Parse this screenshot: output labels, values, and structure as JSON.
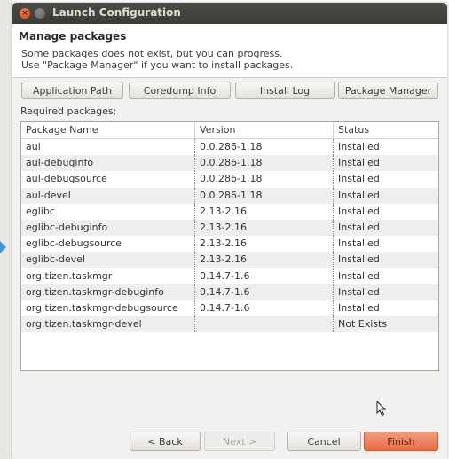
{
  "window": {
    "title": "Launch Configuration"
  },
  "header": {
    "title": "Manage packages",
    "message_line1": "Some packages does not exist, but you can progress.",
    "message_line2": "Use \"Package Manager\" if you want to install packages."
  },
  "buttons": {
    "application_path": "Application Path",
    "coredump_info": "Coredump Info",
    "install_log": "Install Log",
    "package_manager": "Package Manager"
  },
  "required_label": "Required packages:",
  "table": {
    "columns": [
      "Package Name",
      "Version",
      "Status"
    ],
    "rows": [
      {
        "name": "aul",
        "version": "0.0.286-1.18",
        "status": "Installed"
      },
      {
        "name": "aul-debuginfo",
        "version": "0.0.286-1.18",
        "status": "Installed"
      },
      {
        "name": "aul-debugsource",
        "version": "0.0.286-1.18",
        "status": "Installed"
      },
      {
        "name": "aul-devel",
        "version": "0.0.286-1.18",
        "status": "Installed"
      },
      {
        "name": "eglibc",
        "version": "2.13-2.16",
        "status": "Installed"
      },
      {
        "name": "eglibc-debuginfo",
        "version": "2.13-2.16",
        "status": "Installed"
      },
      {
        "name": "eglibc-debugsource",
        "version": "2.13-2.16",
        "status": "Installed"
      },
      {
        "name": "eglibc-devel",
        "version": "2.13-2.16",
        "status": "Installed"
      },
      {
        "name": "org.tizen.taskmgr",
        "version": "0.14.7-1.6",
        "status": "Installed"
      },
      {
        "name": "org.tizen.taskmgr-debuginfo",
        "version": "0.14.7-1.6",
        "status": "Installed"
      },
      {
        "name": "org.tizen.taskmgr-debugsource",
        "version": "0.14.7-1.6",
        "status": "Installed"
      },
      {
        "name": "org.tizen.taskmgr-devel",
        "version": "",
        "status": "Not Exists"
      }
    ]
  },
  "footer": {
    "back": "< Back",
    "next": "Next >",
    "cancel": "Cancel",
    "finish": "Finish"
  }
}
